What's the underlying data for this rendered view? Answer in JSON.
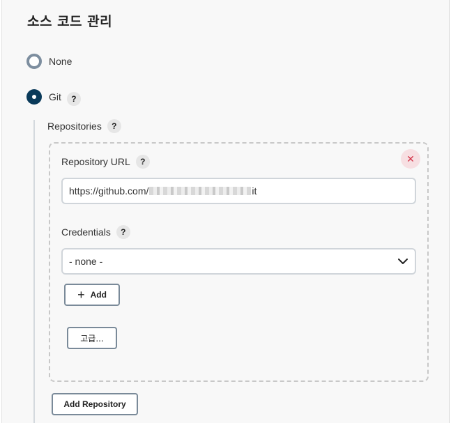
{
  "section": {
    "title": "소스 코드 관리"
  },
  "scm": {
    "options": [
      {
        "label": "None",
        "selected": false
      },
      {
        "label": "Git",
        "selected": true
      }
    ],
    "help_glyph": "?"
  },
  "repositories": {
    "label": "Repositories",
    "repository_url": {
      "label": "Repository URL",
      "value_prefix": "https://github.com/",
      "value_suffix": "it"
    },
    "credentials": {
      "label": "Credentials",
      "selected": "- none -"
    },
    "add_label": "Add",
    "advanced_label": "고급...",
    "delete_glyph": "✕",
    "add_repository_label": "Add Repository"
  },
  "colors": {
    "radio_selected": "#0a3a5a",
    "radio_unselected": "#7d8e9f",
    "delete_button": "#d33448"
  },
  "icons": {
    "help": "question-icon",
    "delete": "close-icon",
    "dropdown": "chevron-down-icon",
    "add": "plus-icon"
  }
}
